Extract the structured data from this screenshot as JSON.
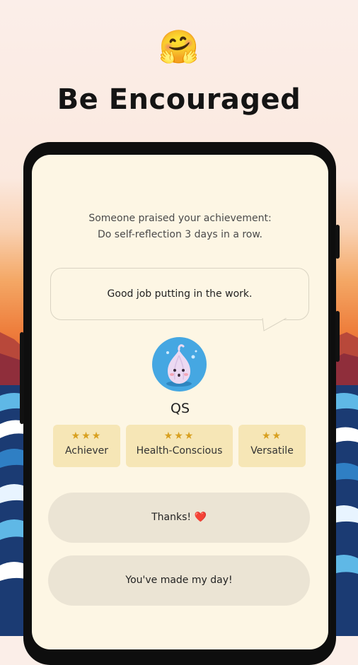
{
  "header": {
    "emoji": "🤗",
    "title": "Be Encouraged"
  },
  "notification": {
    "line1": "Someone praised your achievement:",
    "line2": "Do self-reflection 3 days in a row."
  },
  "message": "Good job putting in the work.",
  "user": {
    "name": "QS"
  },
  "badges": [
    {
      "stars": "★★★",
      "name": "Achiever"
    },
    {
      "stars": "★★★",
      "name": "Health-Conscious"
    },
    {
      "stars": "★★",
      "name": "Versatile"
    }
  ],
  "replies": {
    "thanks": "Thanks! ❤️",
    "made_day": "You've made my day!"
  },
  "colors": {
    "screen_bg": "#fdf6e4",
    "badge_bg": "#f6e6b6",
    "button_bg": "#ebe4d4",
    "star": "#d8a020",
    "avatar_bg": "#45a7e2"
  }
}
